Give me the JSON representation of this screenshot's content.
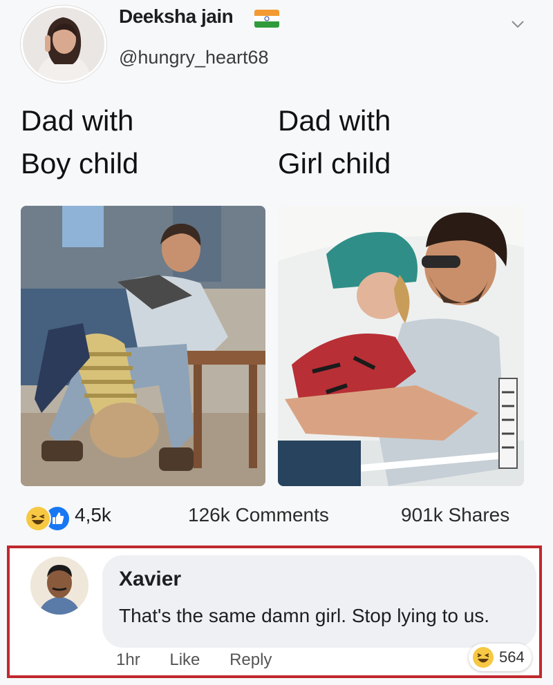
{
  "post": {
    "author_name": "Deeksha jain",
    "author_handle": "@hungry_heart68",
    "flag_icon": "india-flag-icon",
    "caption_left": [
      "Dad with",
      "Boy child"
    ],
    "caption_right": [
      "Dad with",
      "Girl child"
    ]
  },
  "stats": {
    "reactions_count": "4,5k",
    "comments": "126k Comments",
    "shares": "901k Shares"
  },
  "comment": {
    "author": "Xavier",
    "text": "That's the same damn girl. Stop lying to us.",
    "time": "1hr",
    "like_label": "Like",
    "reply_label": "Reply",
    "reaction_count": "564"
  },
  "colors": {
    "highlight_border": "#c0282d",
    "like_blue": "#1877f2",
    "haha_yellow": "#f7c843"
  }
}
